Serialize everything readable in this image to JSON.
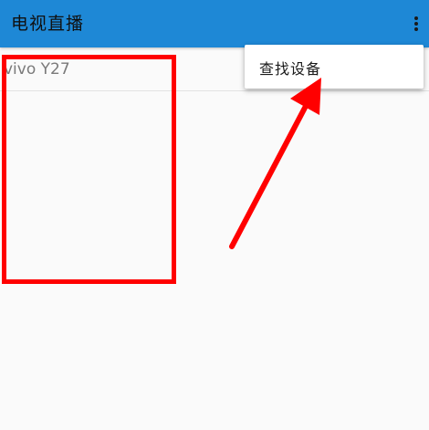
{
  "app_bar": {
    "title": "电视直播",
    "overflow_icon": "more-vert-icon",
    "color": "#1e88d6"
  },
  "device_list": {
    "items": [
      {
        "name": "vivo Y27"
      }
    ]
  },
  "overflow_menu": {
    "items": [
      {
        "label": "查找设备"
      }
    ]
  },
  "annotations": {
    "highlight_color": "#ff0000",
    "arrow_color": "#ff0000"
  }
}
